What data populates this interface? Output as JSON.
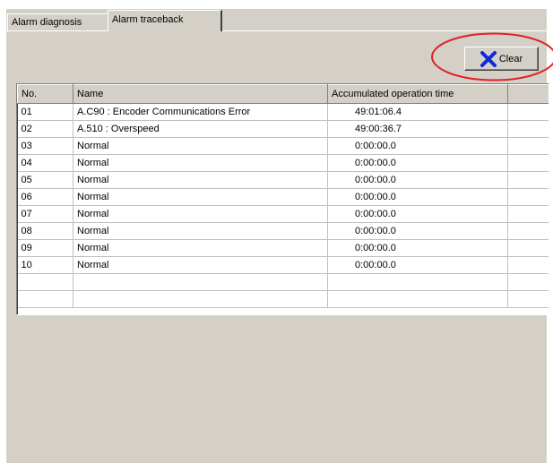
{
  "tabs": [
    {
      "label": "Alarm diagnosis",
      "active": false
    },
    {
      "label": "Alarm traceback",
      "active": true
    }
  ],
  "toolbar": {
    "clear_label": "Clear",
    "clear_icon": "x-icon",
    "icon_color": "#1028d8"
  },
  "highlight_color": "#e02020",
  "table": {
    "columns": [
      "No.",
      "Name",
      "Accumulated operation time",
      ""
    ],
    "rows": [
      {
        "no": "01",
        "name": "A.C90 : Encoder Communications Error",
        "time": "49:01:06.4"
      },
      {
        "no": "02",
        "name": "A.510 : Overspeed",
        "time": "49:00:36.7"
      },
      {
        "no": "03",
        "name": "Normal",
        "time": "0:00:00.0"
      },
      {
        "no": "04",
        "name": "Normal",
        "time": "0:00:00.0"
      },
      {
        "no": "05",
        "name": "Normal",
        "time": "0:00:00.0"
      },
      {
        "no": "06",
        "name": "Normal",
        "time": "0:00:00.0"
      },
      {
        "no": "07",
        "name": "Normal",
        "time": "0:00:00.0"
      },
      {
        "no": "08",
        "name": "Normal",
        "time": "0:00:00.0"
      },
      {
        "no": "09",
        "name": "Normal",
        "time": "0:00:00.0"
      },
      {
        "no": "10",
        "name": "Normal",
        "time": "0:00:00.0"
      },
      {
        "no": "",
        "name": "",
        "time": ""
      },
      {
        "no": "",
        "name": "",
        "time": ""
      }
    ]
  }
}
